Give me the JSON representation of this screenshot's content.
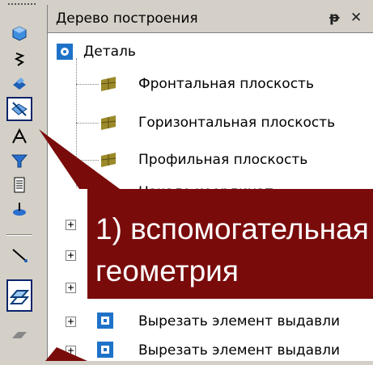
{
  "panel": {
    "title": "Дерево построения",
    "pin_glyph": "ᵽ",
    "close_glyph": "✕"
  },
  "tree": {
    "root": {
      "label": "Деталь",
      "icon": "part-icon"
    },
    "planes": [
      {
        "label": "Фронтальная плоскость",
        "icon": "plane-icon"
      },
      {
        "label": "Горизонтальная плоскость",
        "icon": "plane-icon"
      },
      {
        "label": "Профильная плоскость",
        "icon": "plane-icon"
      }
    ],
    "origin": {
      "label": "Начало координат",
      "icon": "origin-icon"
    },
    "operations": [
      {
        "label": "Вырезать элемент выдавли",
        "icon": "extrude-cut-icon"
      },
      {
        "label": "Вырезать элемент выдавли",
        "icon": "extrude-cut-icon"
      }
    ],
    "expander_glyph": "+"
  },
  "toolbar": {
    "buttons": [
      "extrude-icon",
      "sketch-icon",
      "cut-icon",
      "auxiliary-geometry-icon",
      "measure-icon",
      "filter-icon",
      "spec-icon",
      "edit-icon",
      "line-icon",
      "plane-create-icon",
      "surface-icon"
    ]
  },
  "callout": {
    "text": "1) вспомогательная\nгеометрия",
    "bg_color": "#7a0b0b"
  },
  "colors": {
    "plane_fill": "#9c8a2a",
    "part_blue": "#1e72c8",
    "selection": "#0a246a"
  }
}
